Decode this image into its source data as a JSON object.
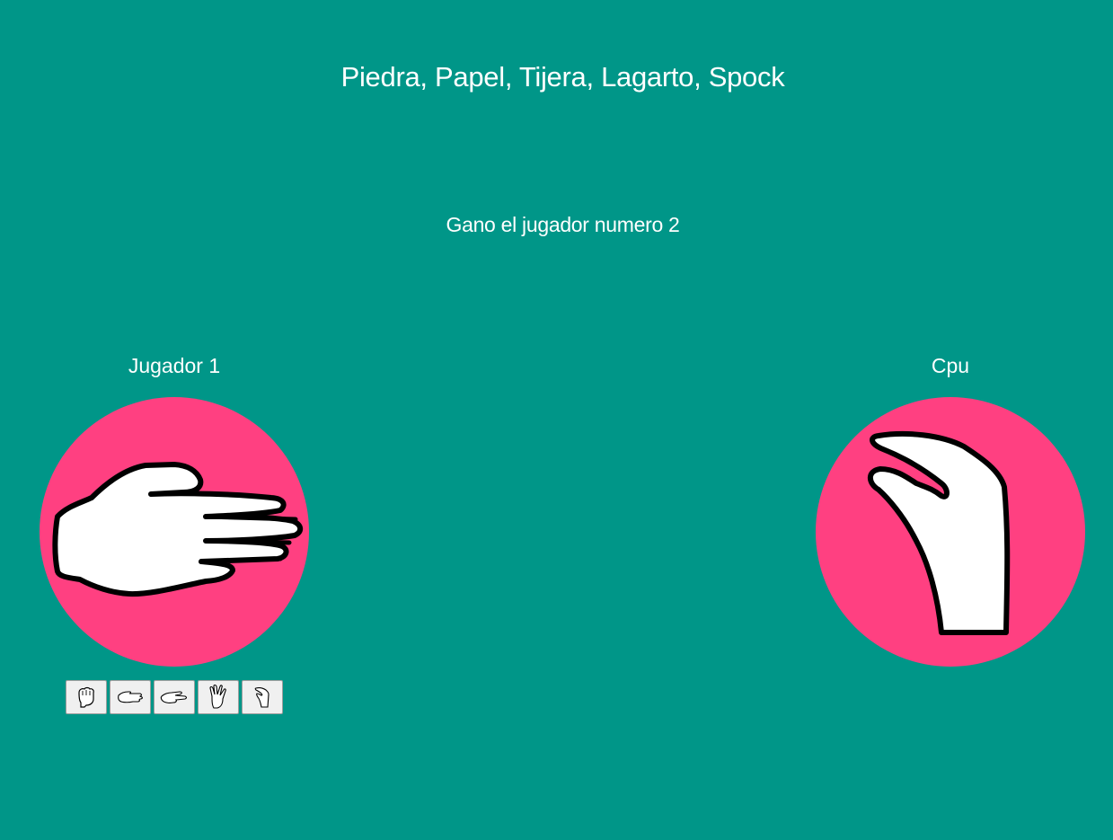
{
  "game": {
    "title": "Piedra, Papel, Tijera, Lagarto, Spock",
    "result": "Gano el jugador numero 2"
  },
  "players": {
    "player1": {
      "label": "Jugador 1",
      "hand": "paper-hand"
    },
    "cpu": {
      "label": "Cpu",
      "hand": "lizard-hand"
    }
  },
  "choices": [
    {
      "name": "piedra",
      "icon": "rock-icon"
    },
    {
      "name": "papel",
      "icon": "paper-icon"
    },
    {
      "name": "tijera",
      "icon": "scissors-icon"
    },
    {
      "name": "spock",
      "icon": "spock-icon"
    },
    {
      "name": "lagarto",
      "icon": "lizard-icon"
    }
  ],
  "colors": {
    "background": "#009688",
    "circle": "#ff4081",
    "text": "#ffffff",
    "button_bg": "#f0f0f0"
  }
}
